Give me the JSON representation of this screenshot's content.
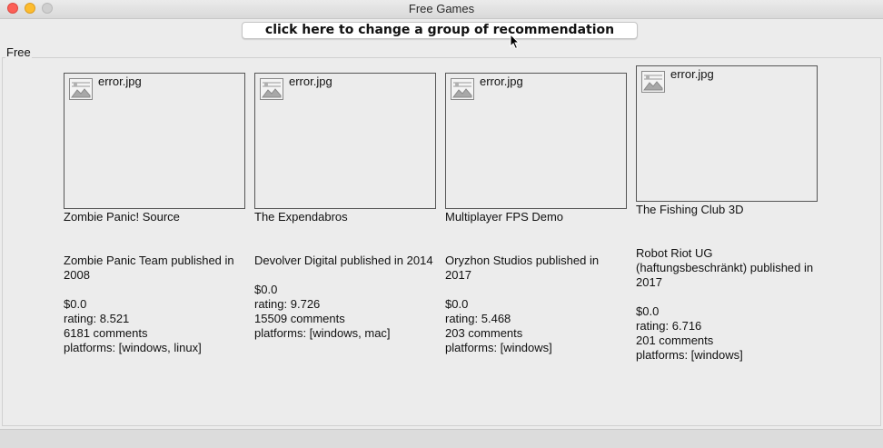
{
  "window": {
    "title": "Free Games"
  },
  "toolbar": {
    "change_group_label": "click here to change a group of recommendation"
  },
  "group": {
    "label": "Free"
  },
  "games": [
    {
      "image_alt": "error.jpg",
      "name": "Zombie Panic! Source",
      "publisher_line": "Zombie Panic Team published in 2008",
      "price": "$0.0",
      "rating": "rating: 8.521",
      "comments": "6181 comments",
      "platforms": "platforms: [windows, linux]"
    },
    {
      "image_alt": "error.jpg",
      "name": "The Expendabros",
      "publisher_line": "Devolver Digital published in 2014",
      "price": "$0.0",
      "rating": "rating: 9.726",
      "comments": "15509 comments",
      "platforms": "platforms: [windows, mac]"
    },
    {
      "image_alt": "error.jpg",
      "name": "Multiplayer FPS Demo",
      "publisher_line": "Oryzhon Studios published in 2017",
      "price": "$0.0",
      "rating": "rating: 5.468",
      "comments": "203 comments",
      "platforms": "platforms: [windows]"
    },
    {
      "image_alt": "error.jpg",
      "name": "The Fishing Club 3D",
      "publisher_line": "Robot Riot UG (haftungsbeschränkt) published in 2017",
      "price": "$0.0",
      "rating": "rating: 6.716",
      "comments": "201 comments",
      "platforms": "platforms: [windows]"
    }
  ]
}
